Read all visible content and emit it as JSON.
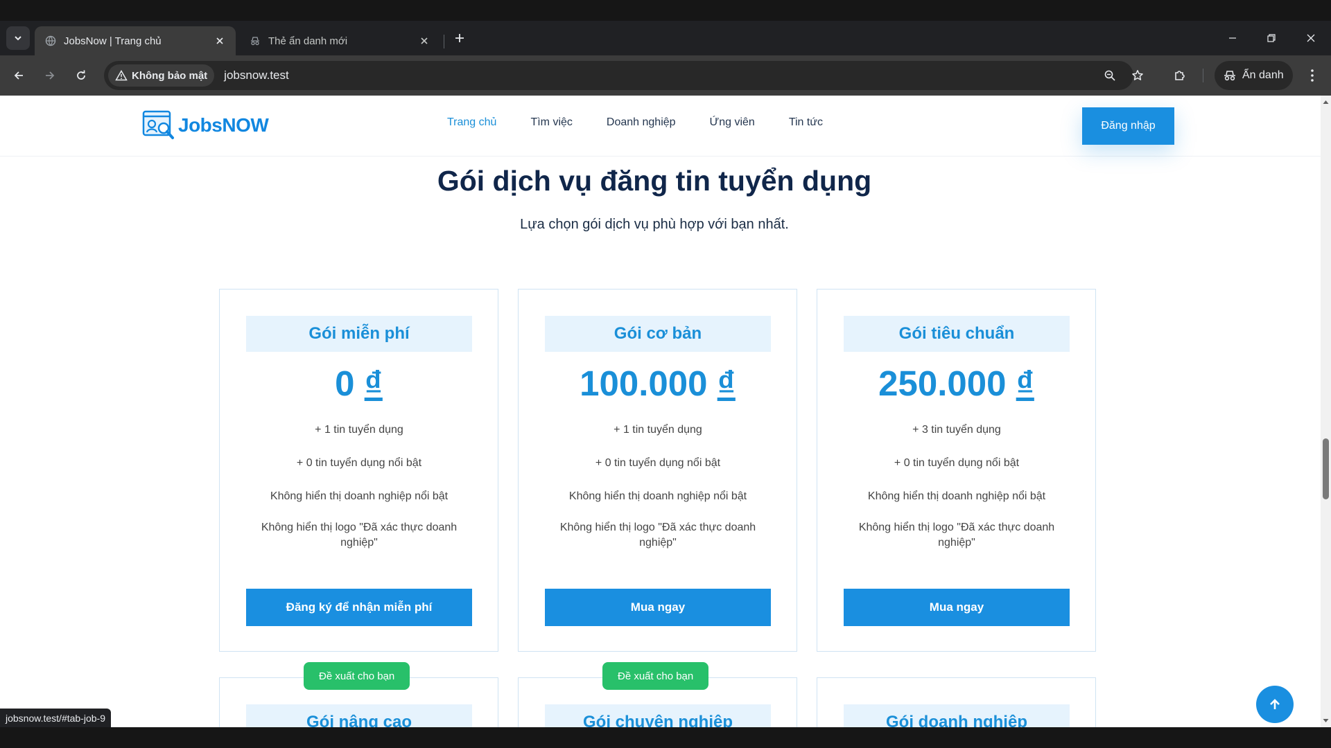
{
  "browser": {
    "tabs": [
      {
        "title": "JobsNow | Trang chủ",
        "active": true
      },
      {
        "title": "Thẻ ẩn danh mới",
        "active": false
      }
    ],
    "security_label": "Không bảo mật",
    "url": "jobsnow.test",
    "profile_label": "Ẩn danh",
    "status_url": "jobsnow.test/#tab-job-9"
  },
  "site": {
    "logo_text": "JobsNOW",
    "nav": [
      "Trang chủ",
      "Tìm việc",
      "Doanh nghiệp",
      "Ứng viên",
      "Tin tức"
    ],
    "login_label": "Đăng nhập"
  },
  "section": {
    "title": "Gói dịch vụ đăng tin tuyển dụng",
    "subtitle": "Lựa chọn gói dịch vụ phù hợp với bạn nhất."
  },
  "plans": [
    {
      "name": "Gói miễn phí",
      "price": "0",
      "currency": "₫",
      "features": [
        "+ 1 tin tuyển dụng",
        "+ 0 tin tuyển dụng nổi bật",
        "Không hiển thị doanh nghiệp nổi bật",
        "Không hiển thị logo \"Đã xác thực doanh nghiệp\""
      ],
      "button": "Đăng ký để nhận miễn phí"
    },
    {
      "name": "Gói cơ bản",
      "price": "100.000",
      "currency": "₫",
      "features": [
        "+ 1 tin tuyển dụng",
        "+ 0 tin tuyển dụng nổi bật",
        "Không hiển thị doanh nghiệp nổi bật",
        "Không hiển thị logo \"Đã xác thực doanh nghiệp\""
      ],
      "button": "Mua ngay"
    },
    {
      "name": "Gói tiêu chuẩn",
      "price": "250.000",
      "currency": "₫",
      "features": [
        "+ 3 tin tuyển dụng",
        "+ 0 tin tuyển dụng nổi bật",
        "Không hiển thị doanh nghiệp nổi bật",
        "Không hiển thị logo \"Đã xác thực doanh nghiệp\""
      ],
      "button": "Mua ngay"
    }
  ],
  "plans_row2": [
    {
      "name": "Gói nâng cao",
      "badge": "Đề xuất cho bạn"
    },
    {
      "name": "Gói chuyên nghiệp",
      "badge": "Đề xuất cho bạn"
    },
    {
      "name": "Gói doanh nghiệp"
    }
  ],
  "colors": {
    "brand_blue": "#1a8fe0",
    "heading_navy": "#10264a",
    "badge_green": "#28c06a"
  }
}
